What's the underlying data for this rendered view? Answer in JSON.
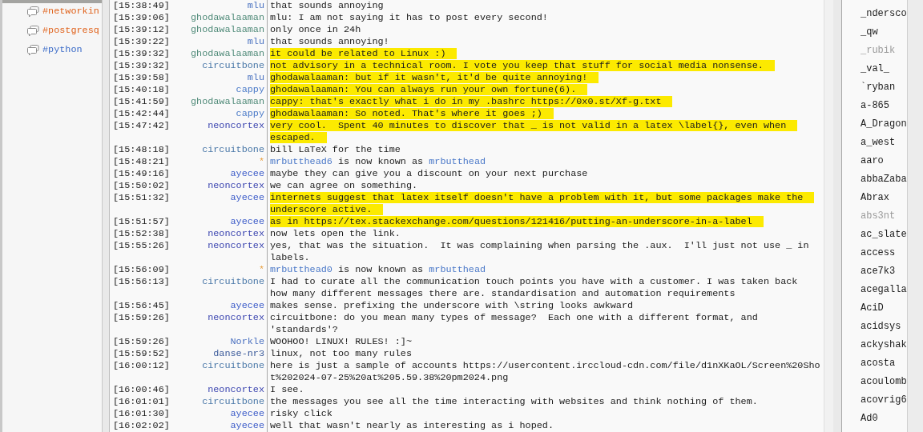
{
  "sidebar": {
    "channels": [
      {
        "name": "#networkin",
        "color": "#e0641e"
      },
      {
        "name": "#postgresq",
        "color": "#e0641e"
      },
      {
        "name": "#python",
        "color": "#3c6cc8"
      }
    ]
  },
  "chat": {
    "messages": [
      {
        "kind": "message",
        "time": "[15:38:49]",
        "nick": "mlu",
        "color": "#4a72c0",
        "highlighted": false,
        "lines": [
          "that sounds annoying"
        ]
      },
      {
        "kind": "message",
        "time": "[15:39:06]",
        "nick": "ghodawalaaman",
        "color": "#4f8a78",
        "highlighted": false,
        "lines": [
          "mlu: I am not saying it has to post every second!"
        ]
      },
      {
        "kind": "message",
        "time": "[15:39:12]",
        "nick": "ghodawalaaman",
        "color": "#4f8a78",
        "highlighted": false,
        "lines": [
          "only once in 24h"
        ]
      },
      {
        "kind": "message",
        "time": "[15:39:22]",
        "nick": "mlu",
        "color": "#4a72c0",
        "highlighted": false,
        "lines": [
          "that sounds annoying!"
        ]
      },
      {
        "kind": "message",
        "time": "[15:39:32]",
        "nick": "ghodawalaaman",
        "color": "#4f8a78",
        "highlighted": true,
        "lines": [
          "it could be related to Linux :)"
        ]
      },
      {
        "kind": "message",
        "time": "[15:39:32]",
        "nick": "circuitbone",
        "color": "#4a78a8",
        "highlighted": true,
        "lines": [
          "not advisory in a technical room. I vote you keep that stuff for social media nonsense."
        ]
      },
      {
        "kind": "message",
        "time": "[15:39:58]",
        "nick": "mlu",
        "color": "#4a72c0",
        "highlighted": true,
        "lines": [
          "ghodawalaaman: but if it wasn't, it'd be quite annoying!"
        ]
      },
      {
        "kind": "message",
        "time": "[15:40:18]",
        "nick": "cappy",
        "color": "#4a7ac8",
        "highlighted": true,
        "lines": [
          "ghodawalaaman: You can always run your own fortune(6)."
        ]
      },
      {
        "kind": "message",
        "time": "[15:41:59]",
        "nick": "ghodawalaaman",
        "color": "#4f8a78",
        "highlighted": true,
        "lines": [
          "cappy: that's exactly what i do in my .bashrc https://0x0.st/Xf-g.txt"
        ]
      },
      {
        "kind": "message",
        "time": "[15:42:44]",
        "nick": "cappy",
        "color": "#4a7ac8",
        "highlighted": true,
        "lines": [
          "ghodawalaaman: So noted. That's where it goes ;)"
        ]
      },
      {
        "kind": "message",
        "time": "[15:47:42]",
        "nick": "neoncortex",
        "color": "#3c46b0",
        "highlighted": true,
        "lines": [
          "very cool.  Spent 40 minutes to discover that _ is not valid in a latex \\label{}, even when",
          "escaped."
        ]
      },
      {
        "kind": "message",
        "time": "[15:48:18]",
        "nick": "circuitbone",
        "color": "#4a78a8",
        "highlighted": false,
        "lines": [
          "bill LaTeX for the time"
        ]
      },
      {
        "kind": "nick_change",
        "time": "[15:48:21]",
        "marker": "*",
        "old": "mrbutthead6",
        "verb": "is now known as",
        "new": "mrbutthead"
      },
      {
        "kind": "message",
        "time": "[15:49:16]",
        "nick": "ayecee",
        "color": "#3a5ac8",
        "highlighted": false,
        "lines": [
          "maybe they can give you a discount on your next purchase"
        ]
      },
      {
        "kind": "message",
        "time": "[15:50:02]",
        "nick": "neoncortex",
        "color": "#3c46b0",
        "highlighted": false,
        "lines": [
          "we can agree on something."
        ]
      },
      {
        "kind": "message",
        "time": "[15:51:32]",
        "nick": "ayecee",
        "color": "#3a5ac8",
        "highlighted": true,
        "lines": [
          "internets suggest that latex itself doesn't have a problem with it, but some packages make the",
          "underscore active."
        ]
      },
      {
        "kind": "message",
        "time": "[15:51:57]",
        "nick": "ayecee",
        "color": "#3a5ac8",
        "highlighted": true,
        "lines": [
          "as in https://tex.stackexchange.com/questions/121416/putting-an-underscore-in-a-label"
        ]
      },
      {
        "kind": "message",
        "time": "[15:52:38]",
        "nick": "neoncortex",
        "color": "#3c46b0",
        "highlighted": false,
        "lines": [
          "now lets open the link."
        ]
      },
      {
        "kind": "message",
        "time": "[15:55:26]",
        "nick": "neoncortex",
        "color": "#3c46b0",
        "highlighted": false,
        "lines": [
          "yes, that was the situation.  It was complaining when parsing the .aux.  I'll just not use _ in",
          "labels."
        ]
      },
      {
        "kind": "nick_change",
        "time": "[15:56:09]",
        "marker": "*",
        "old": "mrbutthead0",
        "verb": "is now known as",
        "new": "mrbutthead"
      },
      {
        "kind": "message",
        "time": "[15:56:13]",
        "nick": "circuitbone",
        "color": "#4a78a8",
        "highlighted": false,
        "lines": [
          "I had to curate all the communication touch points you have with a customer. I was taken back",
          "how many different messages there are. standardisation and automation requirements"
        ]
      },
      {
        "kind": "message",
        "time": "[15:56:45]",
        "nick": "ayecee",
        "color": "#3a5ac8",
        "highlighted": false,
        "lines": [
          "makes sense. prefixing the underscore with \\string looks awkward"
        ]
      },
      {
        "kind": "message",
        "time": "[15:59:26]",
        "nick": "neoncortex",
        "color": "#3c46b0",
        "highlighted": false,
        "lines": [
          "circuitbone: do you mean many types of message?  Each one with a different format, and",
          "'standards'?"
        ]
      },
      {
        "kind": "message",
        "time": "[15:59:26]",
        "nick": "Norkle",
        "color": "#4a70c0",
        "highlighted": false,
        "lines": [
          "WOOHOO! LINUX! RULES! :]~"
        ]
      },
      {
        "kind": "message",
        "time": "[15:59:52]",
        "nick": "danse-nr3",
        "color": "#3a5a9a",
        "highlighted": false,
        "lines": [
          "linux, not too many rules"
        ]
      },
      {
        "kind": "message",
        "time": "[16:00:12]",
        "nick": "circuitbone",
        "color": "#4a78a8",
        "highlighted": false,
        "lines": [
          "here is just a sample of accounts https://usercontent.irccloud-cdn.com/file/d1nXKaOL/Screen%20Sho",
          "t%202024-07-25%20at%205.59.38%20pm2024.png"
        ]
      },
      {
        "kind": "message",
        "time": "[16:00:46]",
        "nick": "neoncortex",
        "color": "#3c46b0",
        "highlighted": false,
        "lines": [
          "I see."
        ]
      },
      {
        "kind": "message",
        "time": "[16:01:01]",
        "nick": "circuitbone",
        "color": "#4a78a8",
        "highlighted": false,
        "lines": [
          "the messages you see all the time interacting with websites and think nothing of them."
        ]
      },
      {
        "kind": "message",
        "time": "[16:01:30]",
        "nick": "ayecee",
        "color": "#3a5ac8",
        "highlighted": false,
        "lines": [
          "risky click"
        ]
      },
      {
        "kind": "message",
        "time": "[16:02:02]",
        "nick": "ayecee",
        "color": "#3a5ac8",
        "highlighted": false,
        "lines": [
          "well that wasn't nearly as interesting as i hoped."
        ]
      }
    ]
  },
  "nicklist": {
    "users": [
      {
        "name": "_ndersco",
        "away": false
      },
      {
        "name": "_qw",
        "away": false
      },
      {
        "name": "_rubik",
        "away": true
      },
      {
        "name": "_val_",
        "away": false
      },
      {
        "name": "`ryban",
        "away": false
      },
      {
        "name": "a-865",
        "away": false
      },
      {
        "name": "A_Dragon",
        "away": false
      },
      {
        "name": "a_west",
        "away": false
      },
      {
        "name": "aaro",
        "away": false
      },
      {
        "name": "abbaZaba",
        "away": false
      },
      {
        "name": "Abrax",
        "away": false
      },
      {
        "name": "abs3nt",
        "away": true
      },
      {
        "name": "ac_slate",
        "away": false
      },
      {
        "name": "access",
        "away": false
      },
      {
        "name": "ace7k3",
        "away": false
      },
      {
        "name": "acegalla",
        "away": false
      },
      {
        "name": "AciD",
        "away": false
      },
      {
        "name": "acidsys",
        "away": false
      },
      {
        "name": "ackyshak",
        "away": false
      },
      {
        "name": "acosta",
        "away": false
      },
      {
        "name": "acoulomb",
        "away": false
      },
      {
        "name": "acovrig6",
        "away": false
      },
      {
        "name": "Ad0",
        "away": false
      }
    ]
  }
}
